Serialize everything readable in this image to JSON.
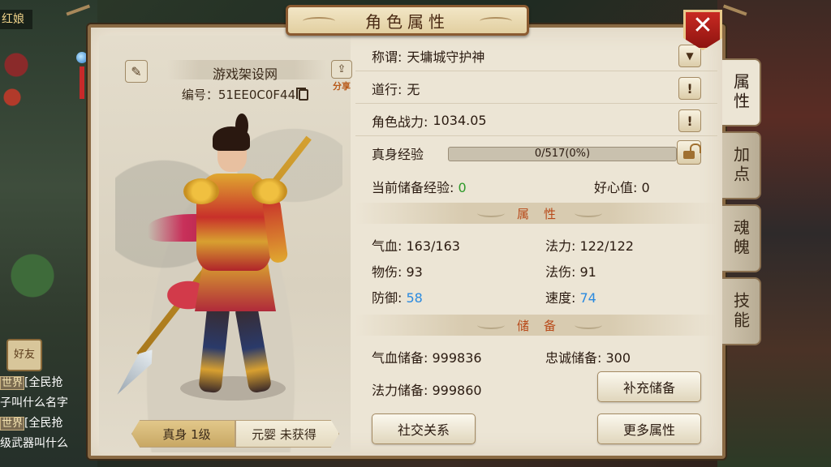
{
  "background": {
    "top_left_name": "红娘",
    "friend_badge": "好友",
    "chat": [
      {
        "tag": "世界",
        "text": "[全民抢"
      },
      {
        "tag": "",
        "text": "子叫什么名字"
      },
      {
        "tag": "世界",
        "text": "[全民抢"
      },
      {
        "tag": "",
        "text": "级武器叫什么"
      }
    ]
  },
  "panel": {
    "title": "角色属性",
    "close_icon": "close-x-icon"
  },
  "character": {
    "name": "游戏架设网",
    "id_text": "编号：51EE0C0F44",
    "share_label": "分享",
    "forms": [
      {
        "label": "真身 1级",
        "active": true
      },
      {
        "label": "元婴 未获得",
        "active": false
      }
    ]
  },
  "info": {
    "title_row": {
      "label": "称谓:",
      "value": "天墉城守护神"
    },
    "dao_row": {
      "label": "道行:",
      "value": "无"
    },
    "power_row": {
      "label": "角色战力:",
      "value": "1034.05"
    },
    "exp_row": {
      "label": "真身经验",
      "bar_text": "0/517(0%)",
      "progress": 0
    },
    "stored_exp_label": "当前储备经验:",
    "stored_exp_value": "0",
    "kindness_label": "好心值:",
    "kindness_value": "0",
    "exclaim": "!"
  },
  "attributes": {
    "section_title": "属性",
    "hp": {
      "label": "气血:",
      "value": "163/163"
    },
    "mp": {
      "label": "法力:",
      "value": "122/122"
    },
    "phys_dmg": {
      "label": "物伤:",
      "value": "93"
    },
    "mag_dmg": {
      "label": "法伤:",
      "value": "91"
    },
    "defense": {
      "label": "防御:",
      "value": "58"
    },
    "speed": {
      "label": "速度:",
      "value": "74"
    }
  },
  "reserve": {
    "section_title": "储备",
    "hp_reserve": {
      "label": "气血储备:",
      "value": "999836"
    },
    "loyalty_reserve": {
      "label": "忠诚储备:",
      "value": "300"
    },
    "mp_reserve": {
      "label": "法力储备:",
      "value": "999860"
    },
    "refill_button": "补充储备"
  },
  "buttons": {
    "social": "社交关系",
    "more_attrs": "更多属性"
  },
  "side_tabs": [
    {
      "label": "属性",
      "active": true
    },
    {
      "label": "加点",
      "active": false
    },
    {
      "label": "魂魄",
      "active": false
    },
    {
      "label": "技能",
      "active": false
    }
  ],
  "colors": {
    "panel_bg": "#ece5d5",
    "accent_green": "#2e9a2a",
    "accent_blue": "#2a8adf",
    "section_title": "#b84a1a",
    "close_red": "#c82a22"
  }
}
